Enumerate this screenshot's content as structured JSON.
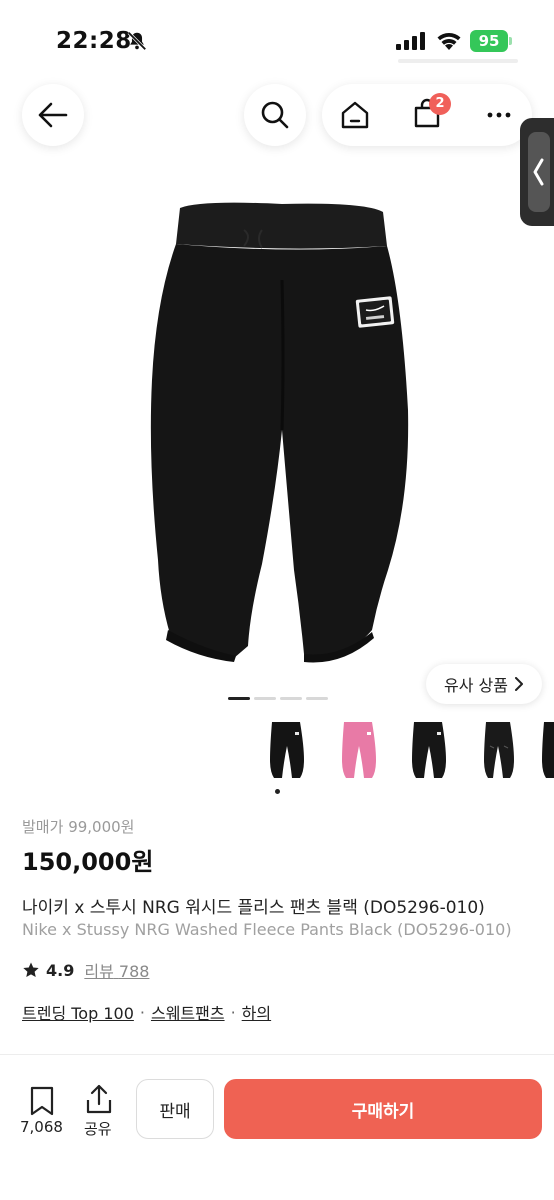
{
  "status_bar": {
    "time": "22:28",
    "battery": "95"
  },
  "nav": {
    "cart_badge": "2"
  },
  "product": {
    "similar_label": "유사 상품",
    "release_label": "발매가",
    "release_price": "99,000원",
    "price": "150,000원",
    "name_ko": "나이키 x 스투시 NRG 워시드 플리스 팬츠 블랙 (DO5296-010)",
    "name_en": "Nike x Stussy NRG Washed Fleece Pants Black (DO5296-010)",
    "rating": "4.9",
    "review_label": "리뷰",
    "review_count": "788",
    "tags": [
      "트렌딩 Top 100",
      "스웨트팬츠",
      "하의"
    ]
  },
  "bottom_bar": {
    "bookmark_count": "7,068",
    "share_label": "공유",
    "sell_label": "판매",
    "buy_label": "구매하기"
  },
  "colors": {
    "accent": "#ef6253",
    "badge": "#f0605a",
    "battery": "#34c759"
  }
}
